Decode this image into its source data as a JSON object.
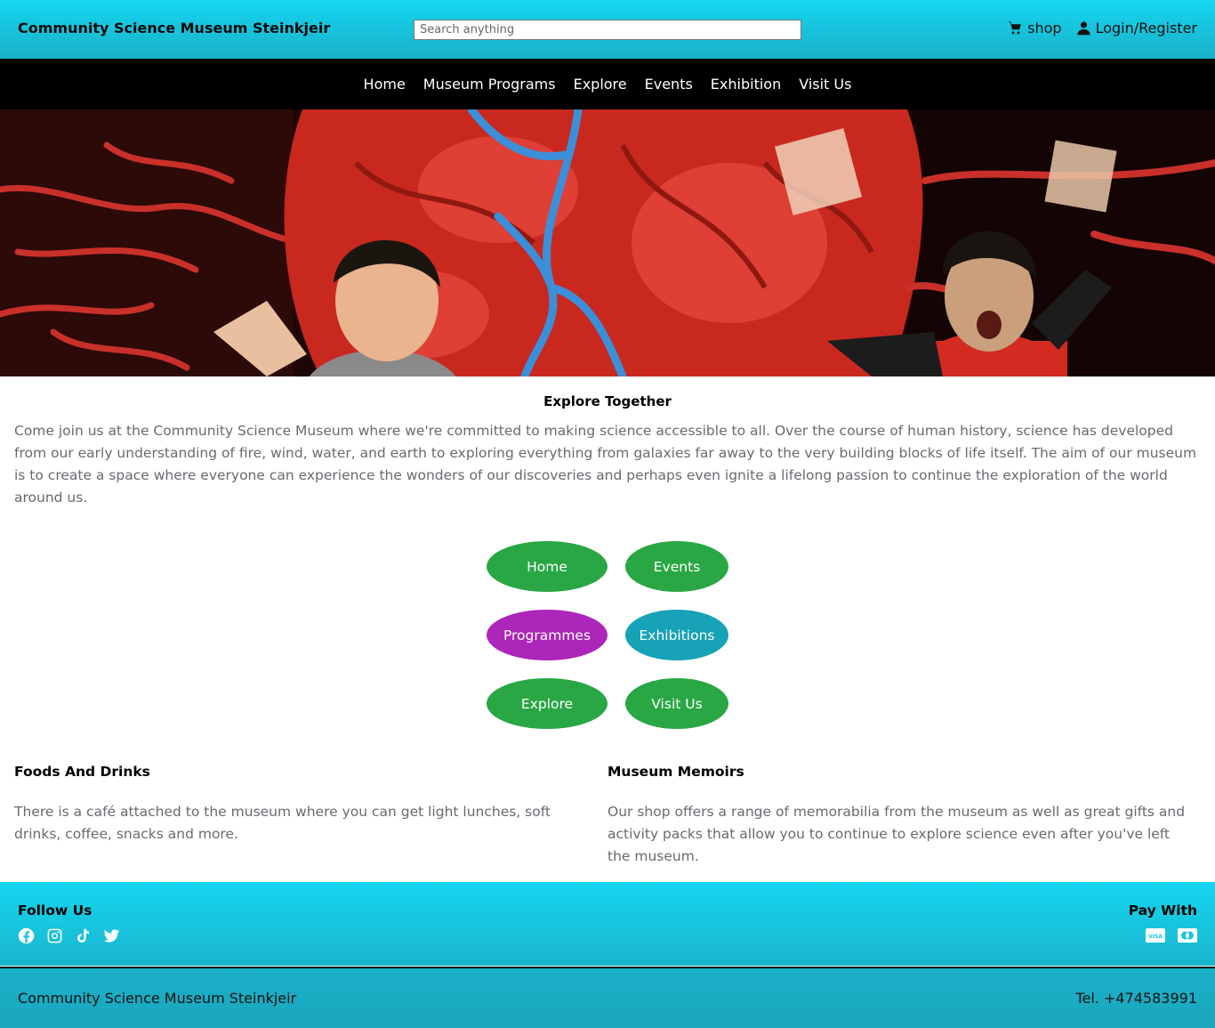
{
  "header": {
    "brand": "Community Science Museum Steinkjeir",
    "search_placeholder": "Search anything",
    "shop_label": "shop",
    "login_label": "Login/Register",
    "shop_icon": "cart-icon",
    "login_icon": "user-icon"
  },
  "nav": {
    "items": [
      "Home",
      "Museum Programs",
      "Explore",
      "Events",
      "Exhibition",
      "Visit Us"
    ]
  },
  "intro": {
    "title": "Explore Together",
    "text": "Come join us at the Community Science Museum where we're committed to making science accessible to all. Over the course of human history, science has developed from our early understanding of fire, wind, water, and earth to exploring everything from galaxies far away to the very building blocks of life itself. The aim of our museum is to create a space where everyone can experience the wonders of our discoveries and perhaps even ignite a lifelong passion to continue the exploration of the world around us."
  },
  "pills": [
    "Home",
    "Events",
    "Programmes",
    "Exhibitions",
    "Explore",
    "Visit Us"
  ],
  "info": {
    "foods_title": "Foods And Drinks",
    "foods_text": "There is a café attached to the museum where you can get light lunches, soft drinks, coffee, snacks and more.",
    "memoirs_title": "Museum Memoirs",
    "memoirs_text": "Our shop offers a range of memorabilia from the museum as well as great gifts and activity packs that allow you to continue to explore science even after you've left the museum."
  },
  "footer": {
    "follow_title": "Follow Us",
    "pay_title": "Pay With",
    "social_icons": [
      "facebook-icon",
      "instagram-icon",
      "tiktok-icon",
      "twitter-icon"
    ],
    "pay_icons": [
      "visa-icon",
      "mastercard-icon"
    ],
    "bottom_left": "Community Science Museum Steinkjeir",
    "bottom_right": "Tel. +474583991"
  },
  "colors": {
    "header_cyan": "#15d6f0",
    "nav_black": "#000000",
    "pill_green": "#29a744",
    "pill_purple": "#ac26b9",
    "pill_teal": "#17a2b8",
    "body_text_gray": "#666b70"
  }
}
